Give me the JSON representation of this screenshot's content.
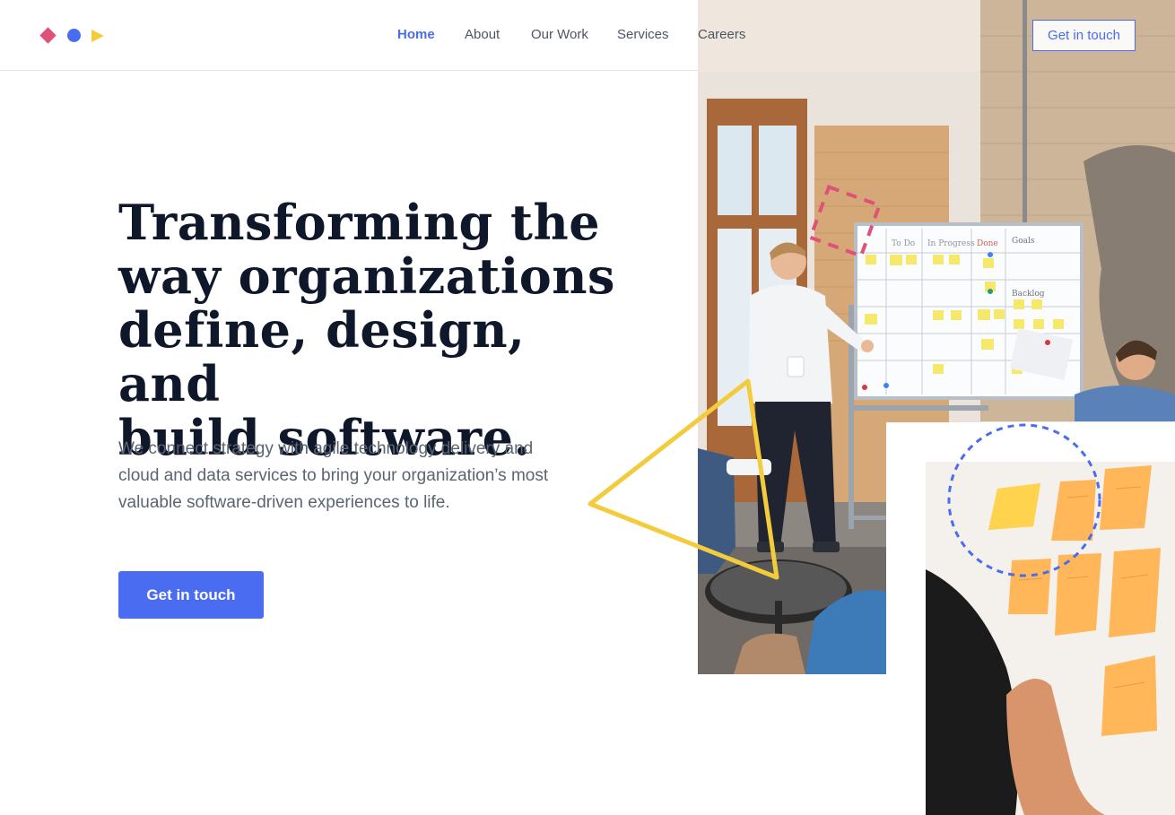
{
  "header": {
    "logo": {
      "shapes": [
        "diamond",
        "circle",
        "triangle"
      ],
      "colors": [
        "#e0517a",
        "#4a6cf0",
        "#f2cc3c"
      ]
    },
    "nav": [
      {
        "label": "Home",
        "active": true
      },
      {
        "label": "About",
        "active": false
      },
      {
        "label": "Our Work",
        "active": false
      },
      {
        "label": "Services",
        "active": false
      },
      {
        "label": "Careers",
        "active": false
      }
    ],
    "cta_label": "Get in touch"
  },
  "hero": {
    "headline_lines": [
      "Transforming the",
      "way organizations",
      "define, design, and",
      "build software."
    ],
    "subcopy_lines": [
      "We connect strategy with agile technology delivery and",
      "cloud and data services to bring your organization’s most",
      "valuable software-driven experiences to life."
    ],
    "cta_label": "Get in touch"
  },
  "board": {
    "columns": [
      "To Do",
      "In Progress",
      "Done",
      "Goals"
    ],
    "backlog_label": "Backlog"
  },
  "colors": {
    "accent": "#4a6cf0",
    "pink": "#e0517a",
    "yellow": "#f2cc3c",
    "heading": "#0f172a",
    "body": "#5b6472"
  }
}
